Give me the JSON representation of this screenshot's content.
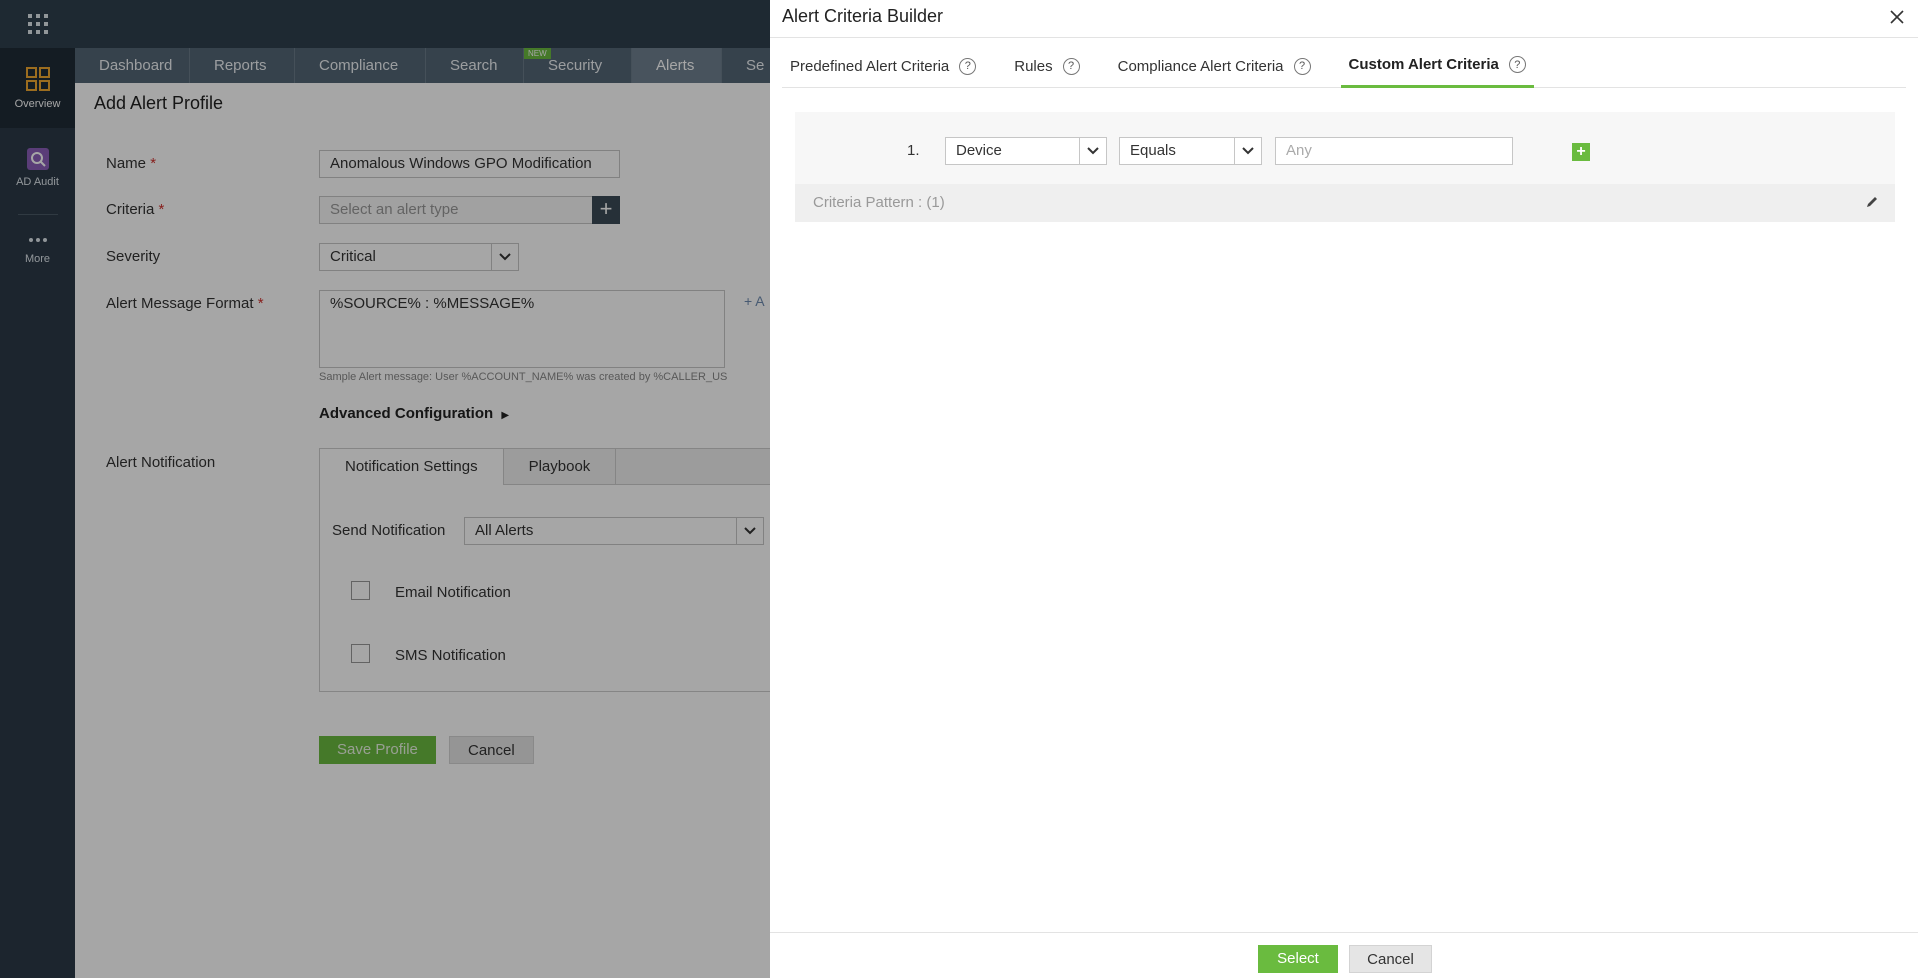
{
  "rail": {
    "items": [
      {
        "label": "Overview"
      },
      {
        "label": "AD Audit"
      },
      {
        "label": "More"
      }
    ]
  },
  "nav": {
    "tabs": [
      "Dashboard",
      "Reports",
      "Compliance",
      "Search",
      "Security",
      "Alerts",
      "Se"
    ],
    "new_badge": "NEW"
  },
  "form": {
    "title": "Add Alert Profile",
    "name_label": "Name",
    "name_value": "Anomalous Windows GPO Modification",
    "criteria_label": "Criteria",
    "criteria_placeholder": "Select an alert type",
    "severity_label": "Severity",
    "severity_value": "Critical",
    "message_label": "Alert Message Format",
    "message_value": "%SOURCE% : %MESSAGE%",
    "sample_hint": "Sample Alert message: User %ACCOUNT_NAME% was created by %CALLER_US",
    "advanced_label": "Advanced Configuration",
    "notification_label": "Alert Notification",
    "notif_tabs": [
      "Notification Settings",
      "Playbook"
    ],
    "send_label": "Send Notification",
    "send_value": "All Alerts",
    "email_label": "Email Notification",
    "sms_label": "SMS Notification",
    "save_label": "Save Profile",
    "cancel_label": "Cancel",
    "add_link_fragment": "+ A",
    "required_mark": "*"
  },
  "dialog": {
    "title": "Alert Criteria Builder",
    "tabs": [
      {
        "label": "Predefined Alert Criteria",
        "active": false
      },
      {
        "label": "Rules",
        "active": false
      },
      {
        "label": "Compliance Alert Criteria",
        "active": false
      },
      {
        "label": "Custom Alert Criteria",
        "active": true
      }
    ],
    "help_glyph": "?",
    "row_number": "1.",
    "field_value": "Device",
    "operator_value": "Equals",
    "value_placeholder": "Any",
    "pattern_text": "Criteria Pattern : (1)",
    "select_label": "Select",
    "cancel_label": "Cancel",
    "add_glyph": "+"
  },
  "colors": {
    "accent_green": "#6abb3f",
    "rail_bg": "#2b3a48",
    "nav_tab_bg": "#546676"
  }
}
